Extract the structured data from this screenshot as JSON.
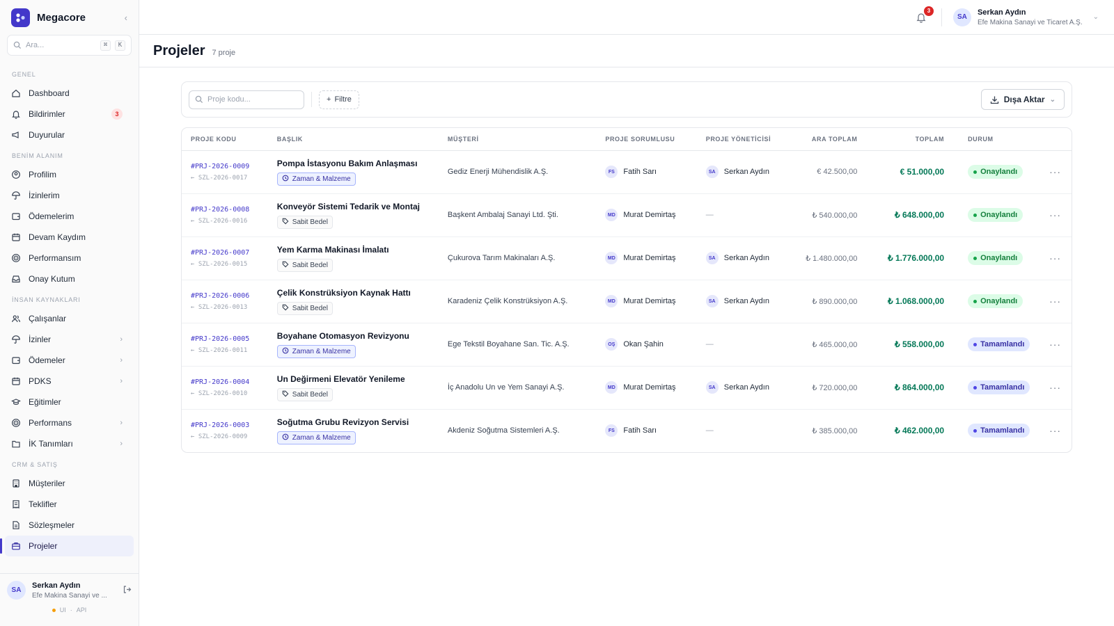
{
  "app": {
    "name": "Megacore"
  },
  "sidebar": {
    "search_placeholder": "Ara...",
    "shortcut": [
      "⌘",
      "K"
    ],
    "sections": [
      {
        "title": "GENEL",
        "items": [
          {
            "label": "Dashboard",
            "icon": "home-icon"
          },
          {
            "label": "Bildirimler",
            "icon": "bell-icon",
            "badge": "3"
          },
          {
            "label": "Duyurular",
            "icon": "megaphone-icon"
          }
        ]
      },
      {
        "title": "BENİM ALANIM",
        "items": [
          {
            "label": "Profilim",
            "icon": "user-circle-icon"
          },
          {
            "label": "İzinlerim",
            "icon": "umbrella-icon"
          },
          {
            "label": "Ödemelerim",
            "icon": "wallet-icon"
          },
          {
            "label": "Devam Kaydım",
            "icon": "calendar-icon"
          },
          {
            "label": "Performansım",
            "icon": "target-icon"
          },
          {
            "label": "Onay Kutum",
            "icon": "inbox-icon"
          }
        ]
      },
      {
        "title": "İNSAN KAYNAKLARI",
        "items": [
          {
            "label": "Çalışanlar",
            "icon": "users-icon"
          },
          {
            "label": "İzinler",
            "icon": "umbrella-icon",
            "chevron": true
          },
          {
            "label": "Ödemeler",
            "icon": "wallet-icon",
            "chevron": true
          },
          {
            "label": "PDKS",
            "icon": "calendar-icon",
            "chevron": true
          },
          {
            "label": "Eğitimler",
            "icon": "graduation-cap-icon"
          },
          {
            "label": "Performans",
            "icon": "target-icon",
            "chevron": true
          },
          {
            "label": "İK Tanımları",
            "icon": "folder-icon",
            "chevron": true
          }
        ]
      },
      {
        "title": "CRM & SATIŞ",
        "items": [
          {
            "label": "Müşteriler",
            "icon": "building-icon"
          },
          {
            "label": "Teklifler",
            "icon": "receipt-icon"
          },
          {
            "label": "Sözleşmeler",
            "icon": "file-text-icon"
          },
          {
            "label": "Projeler",
            "icon": "briefcase-icon",
            "active": true
          }
        ]
      }
    ],
    "user": {
      "initials": "SA",
      "name": "Serkan Aydın",
      "org": "Efe Makina Sanayi ve ..."
    },
    "env": [
      "UI",
      "·",
      "API"
    ]
  },
  "topbar": {
    "notification_count": "3",
    "user": {
      "initials": "SA",
      "name": "Serkan Aydın",
      "org": "Efe Makina Sanayi ve Ticaret A.Ş."
    }
  },
  "page": {
    "title": "Projeler",
    "count": "7 proje"
  },
  "toolbar": {
    "search_placeholder": "Proje kodu...",
    "filter_label": "Filtre",
    "export_label": "Dışa Aktar"
  },
  "table": {
    "headers": [
      "PROJE KODU",
      "BAŞLIK",
      "MÜŞTERİ",
      "PROJE SORUMLUSU",
      "PROJE YÖNETİCİSİ",
      "ARA TOPLAM",
      "TOPLAM",
      "DURUM"
    ],
    "rows": [
      {
        "code": "#PRJ-2026-0009",
        "subcode": "← SZL-2026-0017",
        "title": "Pompa İstasyonu Bakım Anlaşması",
        "tag": "Zaman & Malzeme",
        "tag_type": "tm",
        "customer": "Gediz Enerji Mühendislik A.Ş.",
        "owner": {
          "initials": "FS",
          "name": "Fatih Sarı"
        },
        "manager": {
          "initials": "SA",
          "name": "Serkan Aydın"
        },
        "subtotal": "€ 42.500,00",
        "total": "€ 51.000,00",
        "status": "Onaylandı",
        "status_type": "approved"
      },
      {
        "code": "#PRJ-2026-0008",
        "subcode": "← SZL-2026-0016",
        "title": "Konveyör Sistemi Tedarik ve Montaj",
        "tag": "Sabit Bedel",
        "tag_type": "sb",
        "customer": "Başkent Ambalaj Sanayi Ltd. Şti.",
        "owner": {
          "initials": "MD",
          "name": "Murat Demirtaş"
        },
        "manager": null,
        "subtotal": "₺ 540.000,00",
        "total": "₺ 648.000,00",
        "status": "Onaylandı",
        "status_type": "approved"
      },
      {
        "code": "#PRJ-2026-0007",
        "subcode": "← SZL-2026-0015",
        "title": "Yem Karma Makinası İmalatı",
        "tag": "Sabit Bedel",
        "tag_type": "sb",
        "customer": "Çukurova Tarım Makinaları A.Ş.",
        "owner": {
          "initials": "MD",
          "name": "Murat Demirtaş"
        },
        "manager": {
          "initials": "SA",
          "name": "Serkan Aydın"
        },
        "subtotal": "₺ 1.480.000,00",
        "total": "₺ 1.776.000,00",
        "status": "Onaylandı",
        "status_type": "approved"
      },
      {
        "code": "#PRJ-2026-0006",
        "subcode": "← SZL-2026-0013",
        "title": "Çelik Konstrüksiyon Kaynak Hattı",
        "tag": "Sabit Bedel",
        "tag_type": "sb",
        "customer": "Karadeniz Çelik Konstrüksiyon A.Ş.",
        "owner": {
          "initials": "MD",
          "name": "Murat Demirtaş"
        },
        "manager": {
          "initials": "SA",
          "name": "Serkan Aydın"
        },
        "subtotal": "₺ 890.000,00",
        "total": "₺ 1.068.000,00",
        "status": "Onaylandı",
        "status_type": "approved"
      },
      {
        "code": "#PRJ-2026-0005",
        "subcode": "← SZL-2026-0011",
        "title": "Boyahane Otomasyon Revizyonu",
        "tag": "Zaman & Malzeme",
        "tag_type": "tm",
        "customer": "Ege Tekstil Boyahane San. Tic. A.Ş.",
        "owner": {
          "initials": "OŞ",
          "name": "Okan Şahin"
        },
        "manager": null,
        "subtotal": "₺ 465.000,00",
        "total": "₺ 558.000,00",
        "status": "Tamamlandı",
        "status_type": "done"
      },
      {
        "code": "#PRJ-2026-0004",
        "subcode": "← SZL-2026-0010",
        "title": "Un Değirmeni Elevatör Yenileme",
        "tag": "Sabit Bedel",
        "tag_type": "sb",
        "customer": "İç Anadolu Un ve Yem Sanayi A.Ş.",
        "owner": {
          "initials": "MD",
          "name": "Murat Demirtaş"
        },
        "manager": {
          "initials": "SA",
          "name": "Serkan Aydın"
        },
        "subtotal": "₺ 720.000,00",
        "total": "₺ 864.000,00",
        "status": "Tamamlandı",
        "status_type": "done"
      },
      {
        "code": "#PRJ-2026-0003",
        "subcode": "← SZL-2026-0009",
        "title": "Soğutma Grubu Revizyon Servisi",
        "tag": "Zaman & Malzeme",
        "tag_type": "tm",
        "customer": "Akdeniz Soğutma Sistemleri A.Ş.",
        "owner": {
          "initials": "FS",
          "name": "Fatih Sarı"
        },
        "manager": null,
        "subtotal": "₺ 385.000,00",
        "total": "₺ 462.000,00",
        "status": "Tamamlandı",
        "status_type": "done"
      }
    ],
    "empty_value": "—",
    "row_menu": "···"
  }
}
